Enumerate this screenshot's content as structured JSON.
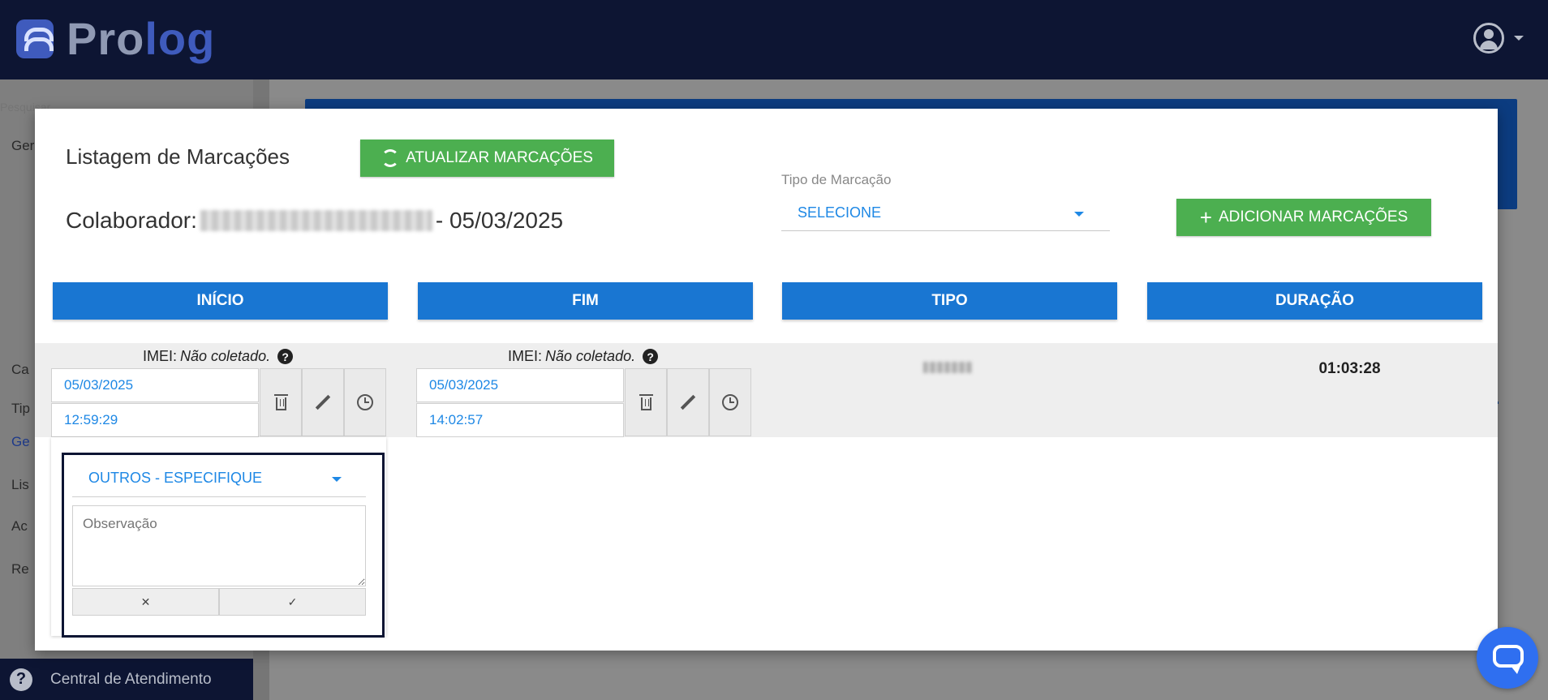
{
  "header": {
    "logo_text_a": "Pro",
    "logo_text_b": "log"
  },
  "sidebar": {
    "search_placeholder": "Pesquisar...",
    "items": [
      "Ger",
      "Ca",
      "Tip",
      "Ge",
      "Lis",
      "Ac",
      "Re"
    ],
    "help_label": "Central de Atendimento"
  },
  "modal": {
    "title": "Listagem de Marcações",
    "refresh_label": "ATUALIZAR MARCAÇÕES",
    "add_label": "ADICIONAR MARCAÇÕES",
    "colaborador_label": "Colaborador:",
    "colaborador_date": "- 05/03/2025",
    "tipo_marcacao_label": "Tipo de Marcação",
    "tipo_marcacao_value": "SELECIONE",
    "columns": [
      "INÍCIO",
      "FIM",
      "TIPO",
      "DURAÇÃO"
    ]
  },
  "row": {
    "imei_label": "IMEI:",
    "imei_value": "Não coletado.",
    "inicio_date": "05/03/2025",
    "inicio_time": "12:59:29",
    "fim_date": "05/03/2025",
    "fim_time": "14:02:57",
    "duracao": "01:03:28"
  },
  "popup": {
    "motivo_value": "OUTROS - ESPECIFIQUE",
    "obs_placeholder": "Observação",
    "cancel_symbol": "✕",
    "confirm_symbol": "✓"
  },
  "colors": {
    "primary": "#1976d2",
    "green": "#4caf50",
    "navy": "#0d1533"
  },
  "icons": [
    "user-icon",
    "refresh-icon",
    "plus-icon",
    "question-icon",
    "trash-icon",
    "pencil-icon",
    "clock-icon",
    "chat-icon"
  ]
}
